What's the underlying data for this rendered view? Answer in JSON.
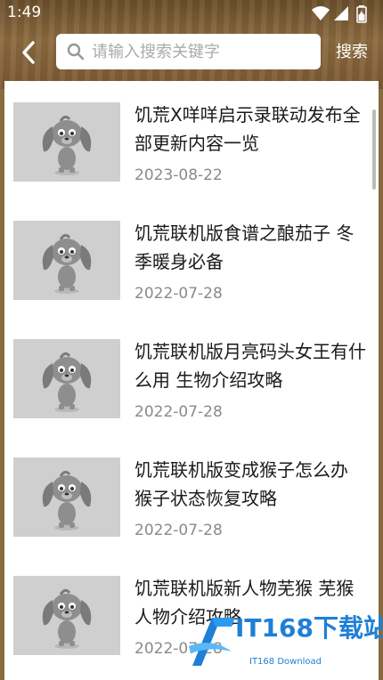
{
  "status_bar": {
    "time": "1:49"
  },
  "toolbar": {
    "search_placeholder": "请输入搜索关键字",
    "search_value": "",
    "search_button_label": "搜索"
  },
  "articles": [
    {
      "title": "饥荒X咩咩启示录联动发布全部更新内容一览",
      "date": "2023-08-22"
    },
    {
      "title": "饥荒联机版食谱之酿茄子 冬季暖身必备",
      "date": "2022-07-28"
    },
    {
      "title": "饥荒联机版月亮码头女王有什么用 生物介绍攻略",
      "date": "2022-07-28"
    },
    {
      "title": "饥荒联机版变成猴子怎么办 猴子状态恢复攻略",
      "date": "2022-07-28"
    },
    {
      "title": "饥荒联机版新人物芜猴 芜猴人物介绍攻略",
      "date": "2022-07-28"
    }
  ],
  "watermark": {
    "text": "IT168下载站",
    "subtext": "IT168 Download"
  },
  "colors": {
    "header_wood": "#7a5a34",
    "watermark_blue": "#1f7fd6",
    "date_gray": "#8a8a8a"
  }
}
